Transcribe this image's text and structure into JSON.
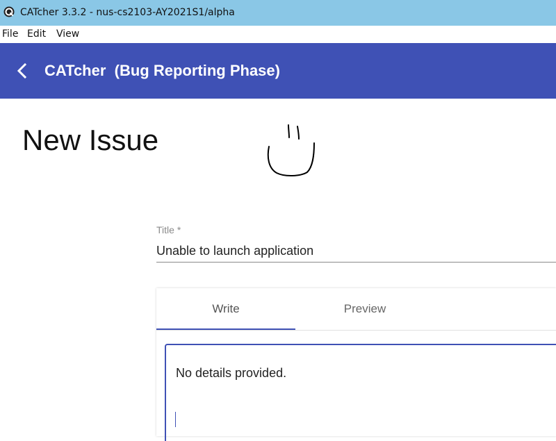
{
  "window": {
    "title": "CATcher 3.3.2 - nus-cs2103-AY2021S1/alpha",
    "icon": "catcher-app-icon"
  },
  "menubar": {
    "items": [
      "File",
      "Edit",
      "View"
    ]
  },
  "toolbar": {
    "back_icon": "chevron-left-icon",
    "title": "CATcher  (Bug Reporting Phase)",
    "color": "#3f51b5"
  },
  "page": {
    "title": "New Issue"
  },
  "form": {
    "title_label": "Title *",
    "title_value": "Unable to launch application"
  },
  "editor": {
    "tabs": [
      {
        "label": "Write",
        "active": true
      },
      {
        "label": "Preview",
        "active": false
      }
    ],
    "description_value": "No details provided."
  },
  "colors": {
    "titlebar": "#8ac7e6",
    "accent": "#3f51b5"
  }
}
